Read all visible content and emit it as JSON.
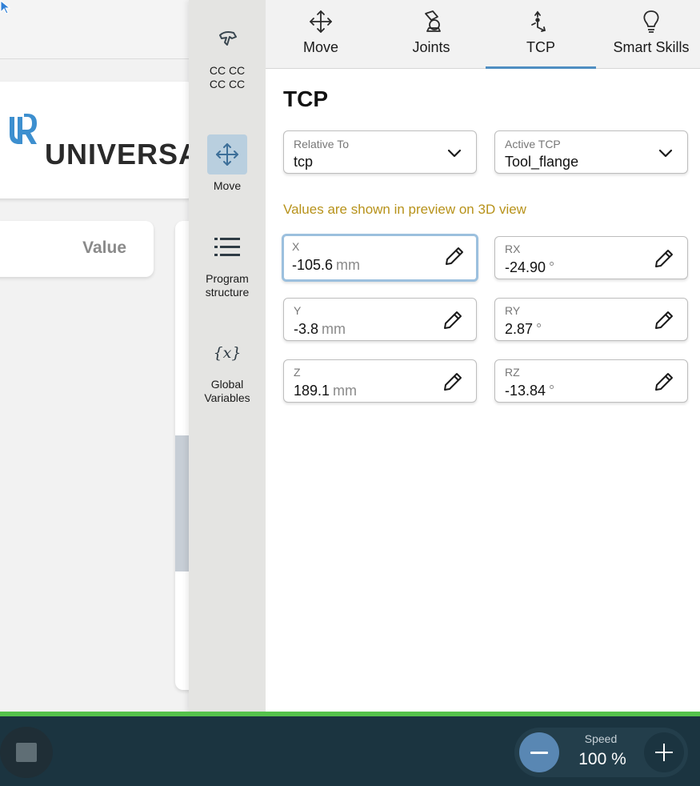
{
  "background": {
    "logo_text": "UNIVERSA",
    "value_header": "Value"
  },
  "sidenav": {
    "items": [
      {
        "label": "CC CC\nCC CC",
        "icon": "gripper-icon"
      },
      {
        "label": "Move",
        "icon": "move-icon",
        "active": true
      },
      {
        "label": "Program\nstructure",
        "icon": "list-icon"
      },
      {
        "label": "Global\nVariables",
        "icon": "variables-icon"
      }
    ]
  },
  "tabs": [
    {
      "label": "Move",
      "icon": "move-arrows-icon"
    },
    {
      "label": "Joints",
      "icon": "joints-icon"
    },
    {
      "label": "TCP",
      "icon": "tcp-icon",
      "active": true
    },
    {
      "label": "Smart Skills",
      "icon": "lightbulb-icon"
    }
  ],
  "tcp": {
    "title": "TCP",
    "relative_to": {
      "label": "Relative To",
      "value": "tcp"
    },
    "active_tcp": {
      "label": "Active TCP",
      "value": "Tool_flange"
    },
    "notice": "Values are shown in preview on 3D view",
    "fields": {
      "x": {
        "label": "X",
        "value": "-105.6",
        "unit": "mm"
      },
      "y": {
        "label": "Y",
        "value": "-3.8",
        "unit": "mm"
      },
      "z": {
        "label": "Z",
        "value": "189.1",
        "unit": "mm"
      },
      "rx": {
        "label": "RX",
        "value": "-24.90",
        "unit": "°"
      },
      "ry": {
        "label": "RY",
        "value": "2.87",
        "unit": "°"
      },
      "rz": {
        "label": "RZ",
        "value": "-13.84",
        "unit": "°"
      }
    }
  },
  "footer": {
    "speed_label": "Speed",
    "speed_value": "100 %"
  },
  "colors": {
    "accent": "#4f8ec2",
    "notice": "#b7921a",
    "bottom_bar": "#1b3440",
    "status_green": "#55c24c"
  }
}
